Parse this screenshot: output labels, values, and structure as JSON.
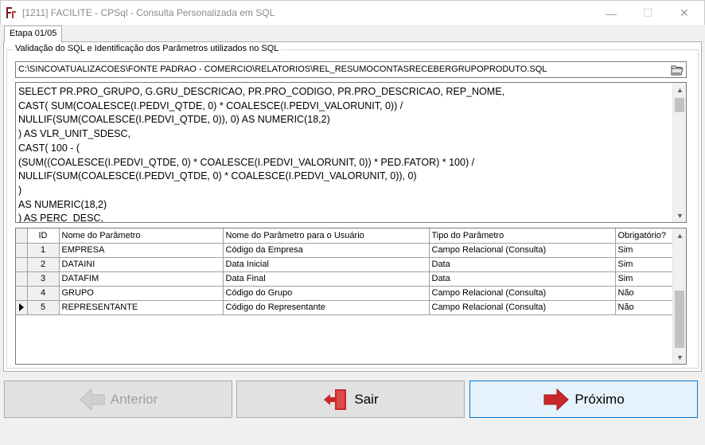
{
  "window": {
    "title": "[1211] FACILITE - CPSql - Consulta Personalizada em SQL",
    "minimize_glyph": "—",
    "maximize_glyph": "☐",
    "close_glyph": "✕"
  },
  "tab": {
    "label": "Etapa 01/05"
  },
  "group": {
    "label": "Validação do SQL e Identificação dos Parâmetros utilizados no SQL"
  },
  "file_path": {
    "value": "C:\\SINCO\\ATUALIZACOES\\FONTE PADRAO - COMERCIO\\RELATORIOS\\REL_RESUMOCONTASRECEBERGRUPOPRODUTO.SQL"
  },
  "sql": {
    "text": "SELECT PR.PRO_GRUPO, G.GRU_DESCRICAO, PR.PRO_CODIGO, PR.PRO_DESCRICAO, REP_NOME,\nCAST( SUM(COALESCE(I.PEDVI_QTDE, 0) * COALESCE(I.PEDVI_VALORUNIT, 0)) /\nNULLIF(SUM(COALESCE(I.PEDVI_QTDE, 0)), 0) AS NUMERIC(18,2)\n) AS VLR_UNIT_SDESC,\nCAST( 100 - (\n(SUM((COALESCE(I.PEDVI_QTDE, 0) * COALESCE(I.PEDVI_VALORUNIT, 0)) * PED.FATOR) * 100) /\nNULLIF(SUM(COALESCE(I.PEDVI_QTDE, 0) * COALESCE(I.PEDVI_VALORUNIT, 0)), 0)\n)\nAS NUMERIC(18,2)\n) AS PERC_DESC,\nCAST("
  },
  "grid": {
    "columns": [
      "ID",
      "Nome do Parâmetro",
      "Nome do Parâmetro para o Usuário",
      "Tipo do Parâmetro",
      "Obrigatório?"
    ],
    "rows": [
      {
        "id": "1",
        "name": "EMPRESA",
        "user_name": "Código da Empresa",
        "type": "Campo Relacional (Consulta)",
        "required": "Sim"
      },
      {
        "id": "2",
        "name": "DATAINI",
        "user_name": "Data Inicial",
        "type": "Data",
        "required": "Sim"
      },
      {
        "id": "3",
        "name": "DATAFIM",
        "user_name": "Data Final",
        "type": "Data",
        "required": "Sim"
      },
      {
        "id": "4",
        "name": "GRUPO",
        "user_name": "Código do Grupo",
        "type": "Campo Relacional (Consulta)",
        "required": "Não"
      },
      {
        "id": "5",
        "name": "REPRESENTANTE",
        "user_name": "Código do Representante",
        "type": "Campo Relacional (Consulta)",
        "required": "Não"
      }
    ],
    "current_row": 5
  },
  "buttons": {
    "prev_label": "Anterior",
    "exit_label": "Sair",
    "next_label": "Próximo"
  },
  "colors": {
    "next_button_border": "#0078d7",
    "arrow_red": "#c8282a",
    "disabled_text": "#a0a0a0"
  }
}
